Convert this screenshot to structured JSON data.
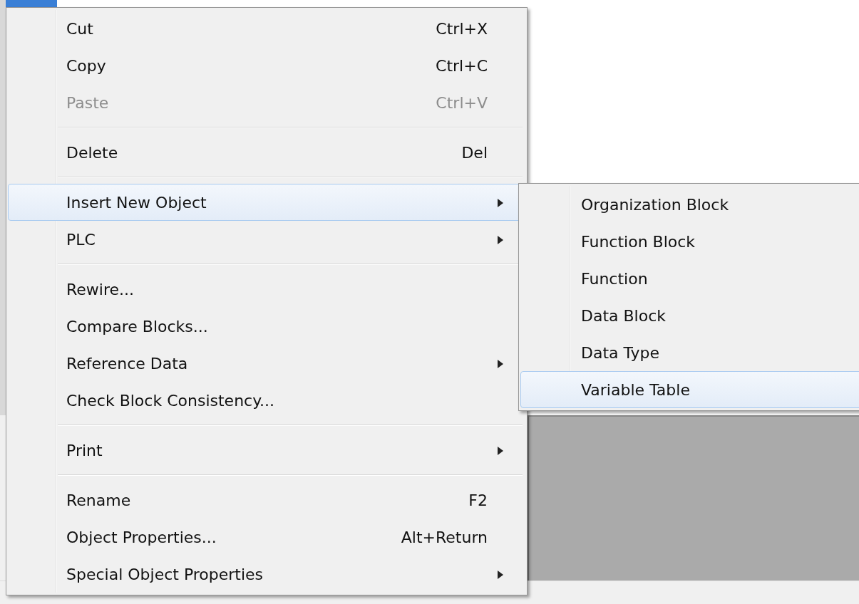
{
  "context_menu": {
    "items": [
      {
        "kind": "item",
        "label": "Cut",
        "shortcut": "Ctrl+X",
        "disabled": false,
        "selected": false,
        "submenu": false
      },
      {
        "kind": "item",
        "label": "Copy",
        "shortcut": "Ctrl+C",
        "disabled": false,
        "selected": false,
        "submenu": false
      },
      {
        "kind": "item",
        "label": "Paste",
        "shortcut": "Ctrl+V",
        "disabled": true,
        "selected": false,
        "submenu": false
      },
      {
        "kind": "separator"
      },
      {
        "kind": "item",
        "label": "Delete",
        "shortcut": "Del",
        "disabled": false,
        "selected": false,
        "submenu": false
      },
      {
        "kind": "separator"
      },
      {
        "kind": "item",
        "label": "Insert New Object",
        "disabled": false,
        "selected": true,
        "submenu": true
      },
      {
        "kind": "item",
        "label": "PLC",
        "disabled": false,
        "selected": false,
        "submenu": true
      },
      {
        "kind": "separator"
      },
      {
        "kind": "item",
        "label": "Rewire...",
        "disabled": false,
        "selected": false,
        "submenu": false
      },
      {
        "kind": "item",
        "label": "Compare Blocks...",
        "disabled": false,
        "selected": false,
        "submenu": false
      },
      {
        "kind": "item",
        "label": "Reference Data",
        "disabled": false,
        "selected": false,
        "submenu": true
      },
      {
        "kind": "item",
        "label": "Check Block Consistency...",
        "disabled": false,
        "selected": false,
        "submenu": false
      },
      {
        "kind": "separator"
      },
      {
        "kind": "item",
        "label": "Print",
        "disabled": false,
        "selected": false,
        "submenu": true
      },
      {
        "kind": "separator"
      },
      {
        "kind": "item",
        "label": "Rename",
        "shortcut": "F2",
        "disabled": false,
        "selected": false,
        "submenu": false
      },
      {
        "kind": "item",
        "label": "Object Properties...",
        "shortcut": "Alt+Return",
        "disabled": false,
        "selected": false,
        "submenu": false
      },
      {
        "kind": "item",
        "label": "Special Object Properties",
        "disabled": false,
        "selected": false,
        "submenu": true
      }
    ]
  },
  "submenu": {
    "items": [
      {
        "label": "Organization Block",
        "selected": false
      },
      {
        "label": "Function Block",
        "selected": false
      },
      {
        "label": "Function",
        "selected": false
      },
      {
        "label": "Data Block",
        "selected": false
      },
      {
        "label": "Data Type",
        "selected": false
      },
      {
        "label": "Variable Table",
        "selected": true
      }
    ]
  }
}
